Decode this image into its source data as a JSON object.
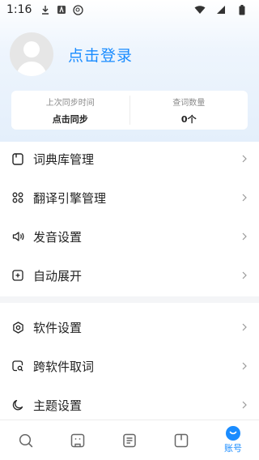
{
  "status_bar": {
    "time": "1:16"
  },
  "profile": {
    "login_text": "点击登录"
  },
  "sync": {
    "left_label": "上次同步时间",
    "left_value": "点击同步",
    "right_label": "查词数量",
    "right_value": "0个"
  },
  "menu": {
    "group1": [
      {
        "label": "词典库管理",
        "icon": "dictionary-icon"
      },
      {
        "label": "翻译引擎管理",
        "icon": "grid-icon"
      },
      {
        "label": "发音设置",
        "icon": "speaker-icon"
      },
      {
        "label": "自动展开",
        "icon": "expand-icon"
      }
    ],
    "group2": [
      {
        "label": "软件设置",
        "icon": "settings-icon"
      },
      {
        "label": "跨软件取词",
        "icon": "search-word-icon"
      },
      {
        "label": "主题设置",
        "icon": "moon-icon"
      }
    ]
  },
  "bottom_nav": {
    "items": [
      {
        "icon": "search-icon"
      },
      {
        "icon": "translate-icon"
      },
      {
        "icon": "notes-icon"
      },
      {
        "icon": "book-icon"
      },
      {
        "icon": "account-icon",
        "label": "账号"
      }
    ]
  },
  "colors": {
    "accent": "#1a8cff",
    "text": "#222222",
    "muted": "#8a8a8a"
  }
}
